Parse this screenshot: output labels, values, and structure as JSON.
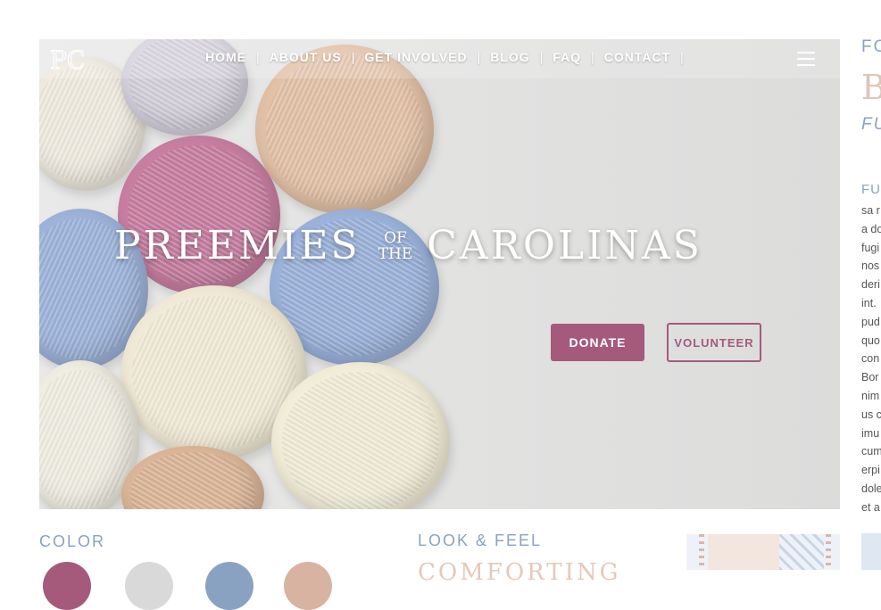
{
  "brand": {
    "logo_text": "PC"
  },
  "nav": {
    "items": [
      {
        "label": "HOME"
      },
      {
        "label": "ABOUT US"
      },
      {
        "label": "GET INVOLVED"
      },
      {
        "label": "BLOG"
      },
      {
        "label": "FAQ"
      },
      {
        "label": "CONTACT"
      }
    ],
    "separator": "|"
  },
  "hero": {
    "title_left": "PREEMIES",
    "title_of": "OF",
    "title_the": "THE",
    "title_right": "CAROLINAS",
    "donate_label": "DONATE",
    "volunteer_label": "VOLUNTEER"
  },
  "right_strip": {
    "heading1": "FO",
    "heading2": "B",
    "heading3": "FU",
    "heading4": "FU",
    "lines": [
      "sa r",
      "a do",
      "fugi",
      "nos",
      "deri",
      "int.",
      "pud",
      "quo",
      "con",
      "Bor",
      "nim",
      "us c",
      "imu",
      "cum",
      "erpi",
      "dole",
      "et a"
    ]
  },
  "bottom": {
    "color_label": "COLOR",
    "look_label": "LOOK & FEEL",
    "comforting_label": "COMFORTING"
  },
  "colors": {
    "accent": "#a55a7c",
    "light_blue": "#8aa2c2",
    "swatches": [
      "#a55a7c",
      "#d9d9d9",
      "#8aa2c2",
      "#d8b3a1"
    ]
  },
  "icons": {
    "menu": "hamburger-menu-icon"
  }
}
